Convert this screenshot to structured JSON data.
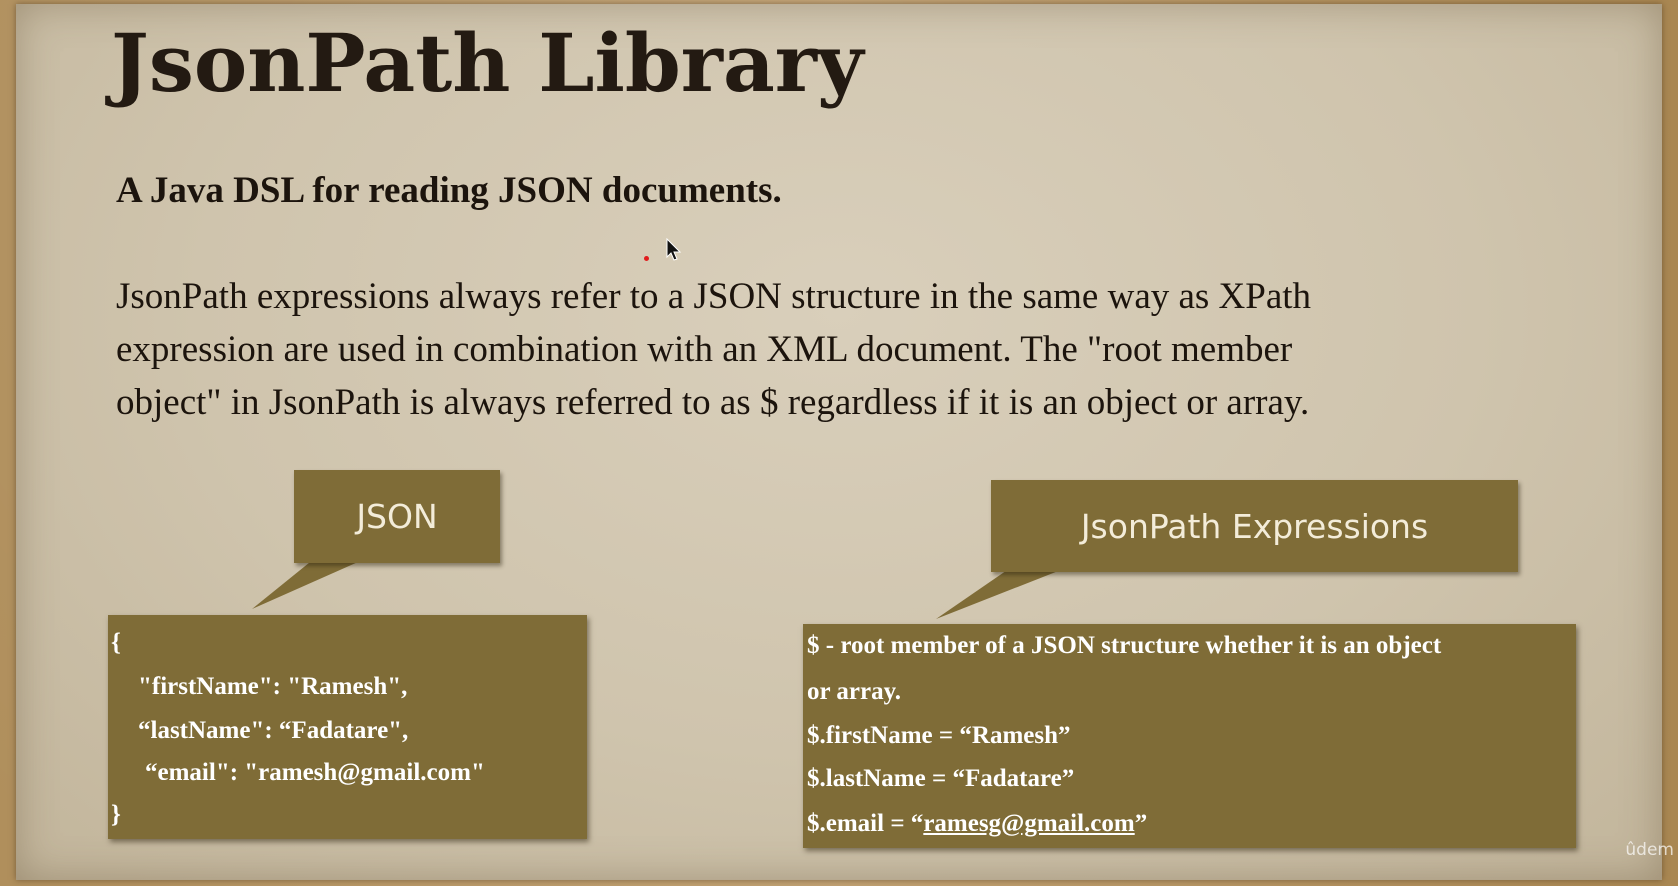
{
  "slide": {
    "title": "JsonPath Library",
    "subtitle": "A Java DSL for reading JSON documents.",
    "description_lines": [
      "JsonPath expressions always refer to a JSON structure in the same way as XPath",
      "expression are used in combination with an XML document. The \"root member",
      "object\" in JsonPath is always referred to as $ regardless if it is an object or array."
    ]
  },
  "json_callout": {
    "label": "JSON",
    "lines": [
      "{",
      "\"firstName\": \"Ramesh\",",
      "“lastName\": “Fadatare\",",
      "“email\": \"ramesh@gmail.com\"",
      "}"
    ]
  },
  "expr_callout": {
    "label": "JsonPath Expressions",
    "lines": [
      "$ - root member of a JSON structure whether it is an object",
      "or array.",
      "$.firstName = “Ramesh”",
      "$.lastName = “Fadatare”"
    ],
    "email_prefix": "$.email = “",
    "email_link": "ramesg@gmail.com",
    "email_suffix": "”"
  },
  "watermark": "ûdem",
  "colors": {
    "callout_bg": "#7f6c37",
    "slide_bg": "#d4c9b3",
    "pointer_dot": "#e11d1d"
  }
}
